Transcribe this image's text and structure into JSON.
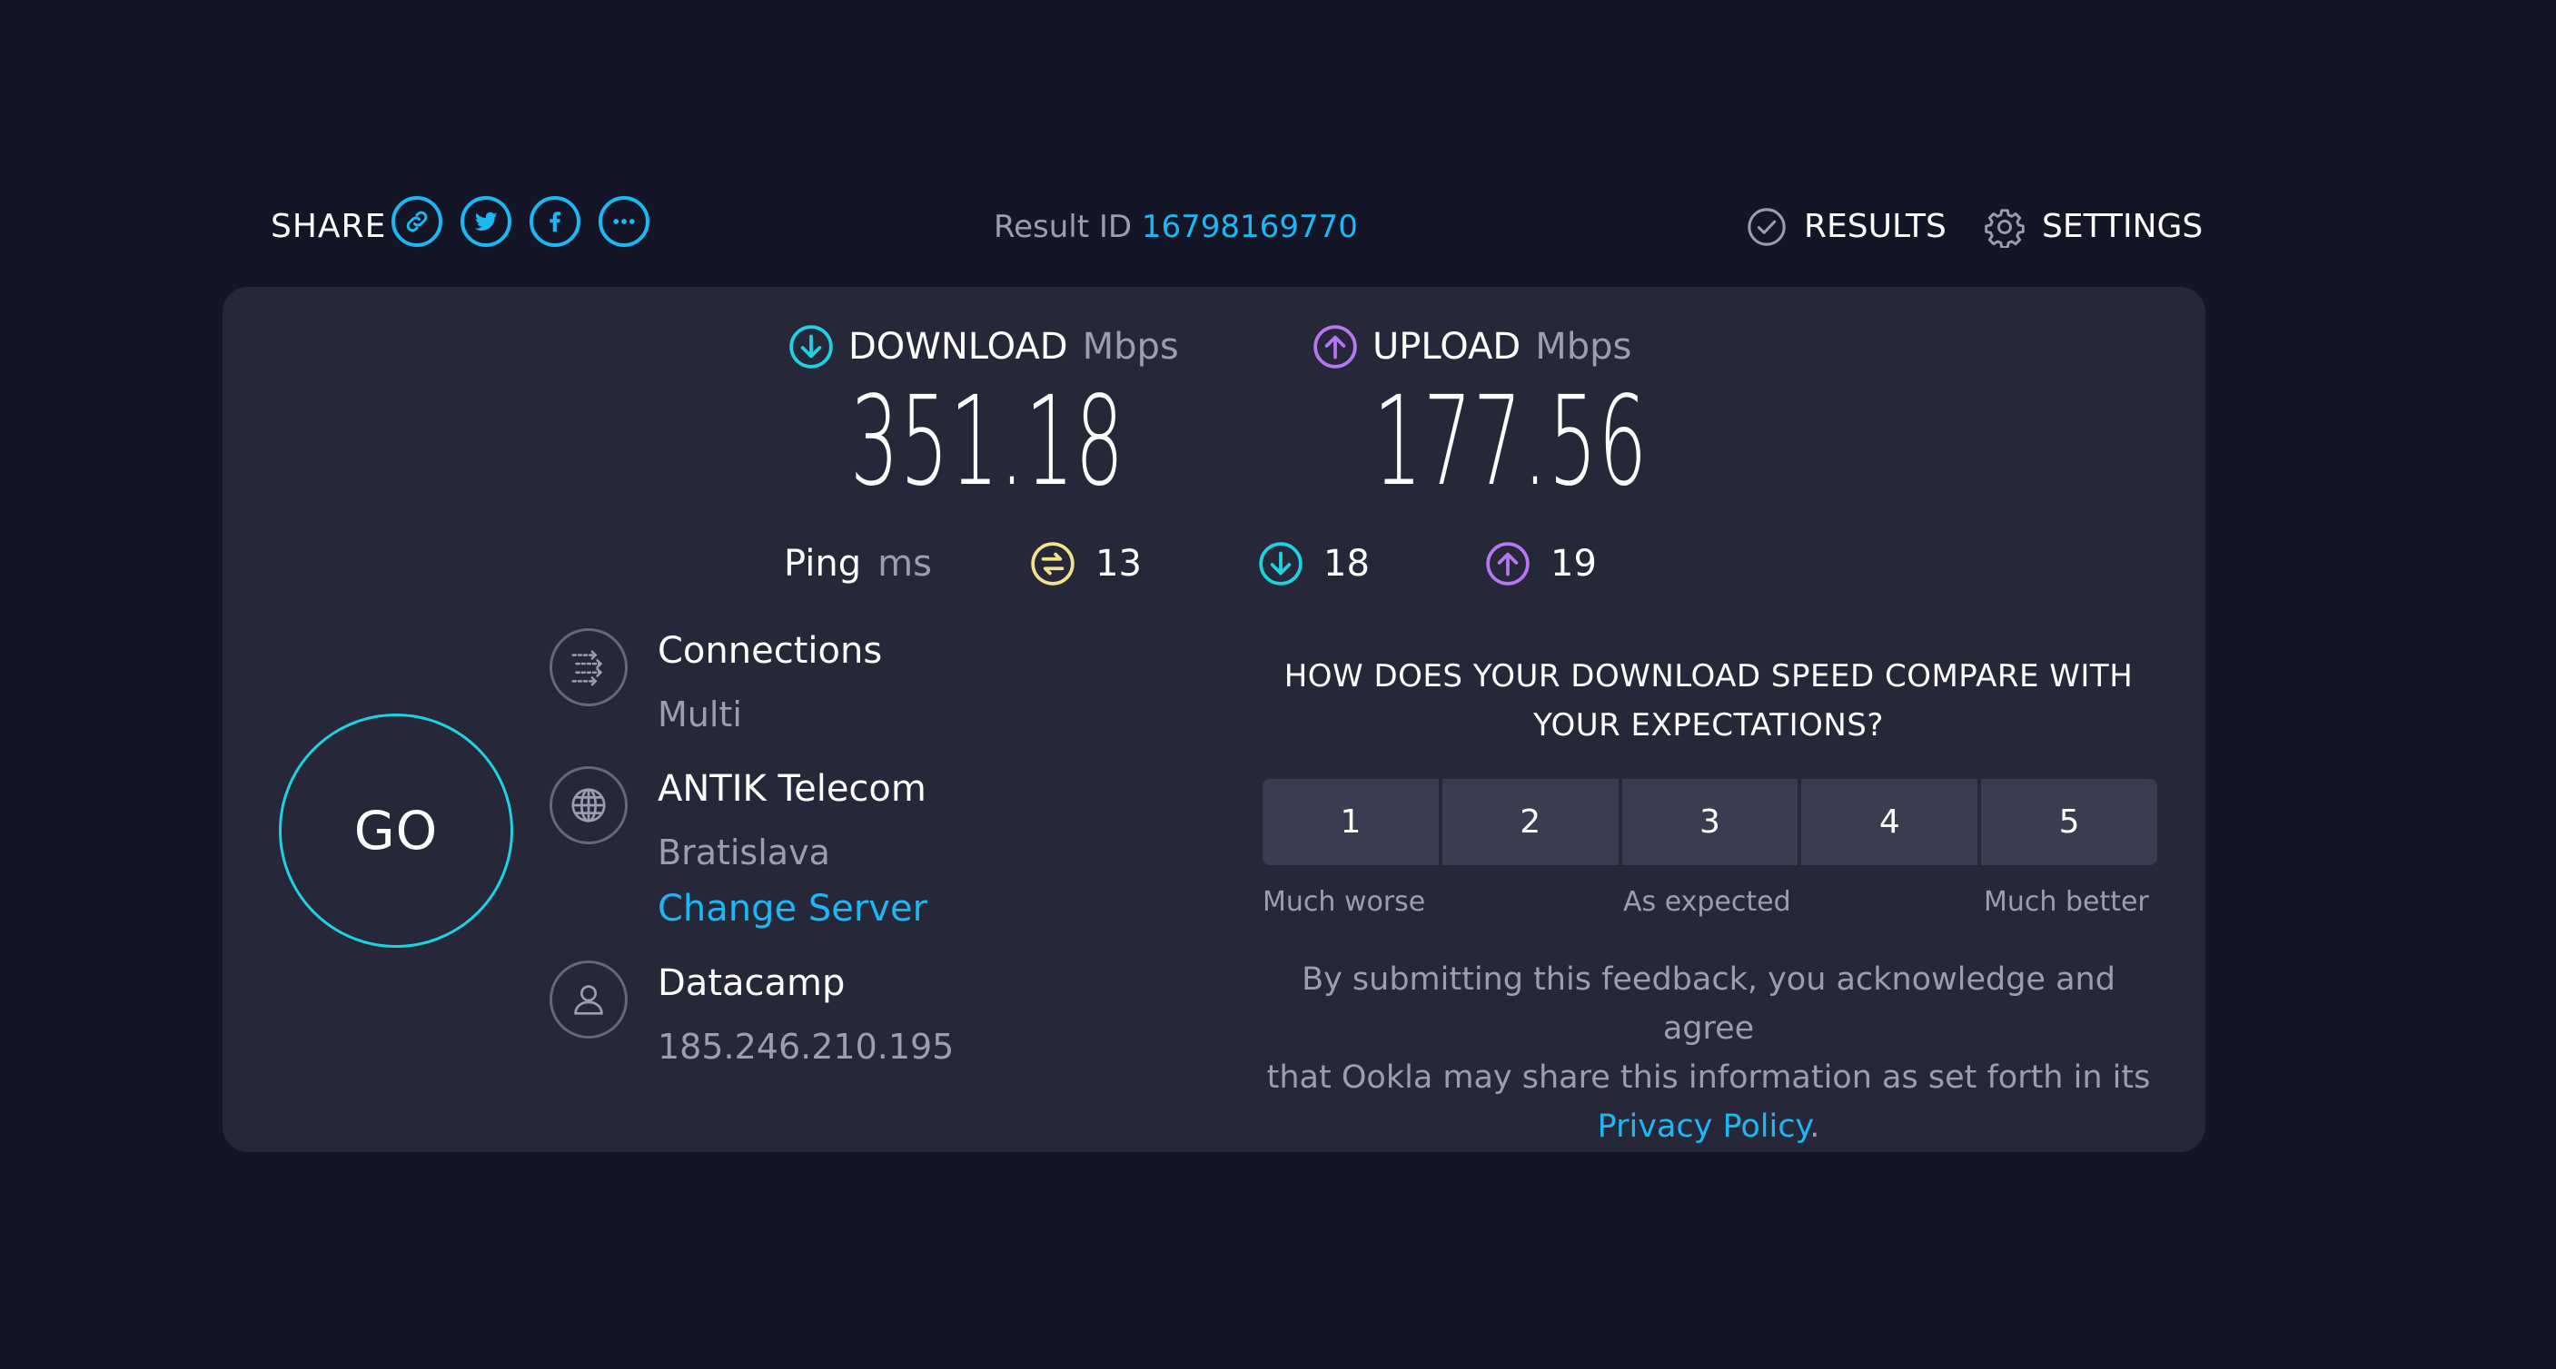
{
  "header": {
    "share_label": "SHARE",
    "share_buttons": [
      "link-icon",
      "twitter-icon",
      "facebook-icon",
      "more-icon"
    ],
    "result_id_label": "Result ID",
    "result_id_value": "16798169770",
    "results_label": "RESULTS",
    "settings_label": "SETTINGS"
  },
  "download": {
    "label": "DOWNLOAD",
    "unit": "Mbps",
    "value": "351.18",
    "icon_color": "#1ed2e4"
  },
  "upload": {
    "label": "UPLOAD",
    "unit": "Mbps",
    "value": "177.56",
    "icon_color": "#b876f2"
  },
  "ping": {
    "label": "Ping",
    "unit": "ms",
    "idle": "13",
    "download": "18",
    "upload": "19",
    "idle_color": "#f2e38a"
  },
  "go_label": "GO",
  "connections": {
    "title": "Connections",
    "value": "Multi"
  },
  "server": {
    "title": "ANTIK Telecom",
    "location": "Bratislava",
    "change_label": "Change Server"
  },
  "provider": {
    "title": "Datacamp",
    "ip": "185.246.210.195"
  },
  "feedback": {
    "question_line1": "HOW DOES YOUR DOWNLOAD SPEED COMPARE WITH",
    "question_line2": "YOUR EXPECTATIONS?",
    "ratings": [
      "1",
      "2",
      "3",
      "4",
      "5"
    ],
    "scale_low": "Much worse",
    "scale_mid": "As expected",
    "scale_high": "Much better",
    "disclaimer_line1": "By submitting this feedback, you acknowledge and agree",
    "disclaimer_line2": "that Ookla may share this information as set forth in its",
    "privacy_link": "Privacy Policy",
    "period": "."
  },
  "colors": {
    "background": "#141627",
    "panel": "#262839",
    "accent_blue": "#1cb8f5",
    "accent_cyan": "#1ed2e4",
    "accent_purple": "#b876f2"
  }
}
